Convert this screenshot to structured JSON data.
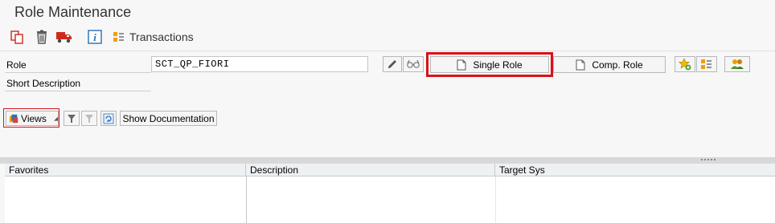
{
  "window": {
    "title": "Role Maintenance"
  },
  "toolbar": {
    "icons": [
      "copy-icon",
      "delete-icon",
      "transport-icon",
      "info-icon",
      "transactions-icon"
    ],
    "transactions_label": "Transactions"
  },
  "form": {
    "role_label": "Role",
    "role_value": "SCT_QP_FIORI",
    "short_desc_label": "Short Description",
    "single_role_label": "Single Role",
    "comp_role_label": "Comp. Role"
  },
  "views_toolbar": {
    "views_label": "Views",
    "show_doc_label": "Show Documentation"
  },
  "grid": {
    "columns": [
      "Favorites",
      "Description",
      "Target Sys"
    ],
    "rows": []
  },
  "colors": {
    "highlight": "#d8121a",
    "accent_orange": "#f0a000",
    "accent_red": "#cc2a1a",
    "accent_blue": "#2a6fb4"
  }
}
